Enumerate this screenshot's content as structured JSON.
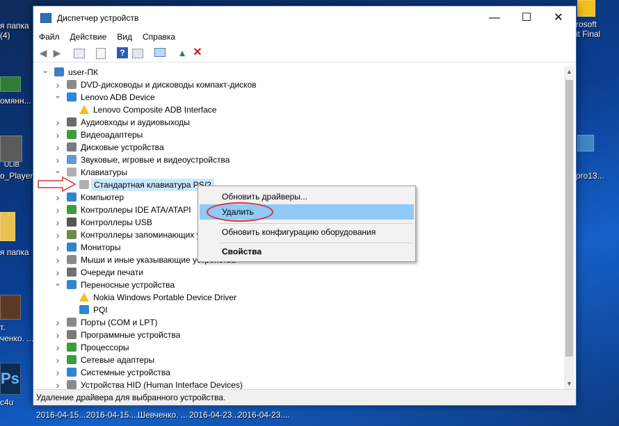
{
  "desktop": {
    "left_labels": [
      "я папка",
      "(4)",
      "омянн...",
      "o_Player",
      "я папка",
      "т.",
      "ченко. ...",
      "c4u"
    ],
    "right_labels": [
      "rosoft",
      "it Final",
      "pro13..."
    ],
    "taskbar_items": [
      "2016-04-15....",
      "2016-04-15....",
      "Шевченко. ...",
      "2016-04-23....",
      "2016-04-23...."
    ],
    "icon_label": "ULIB"
  },
  "window": {
    "title": "Диспетчер устройств",
    "minimize_glyph": "—",
    "maximize_glyph": "☐",
    "close_glyph": "✕",
    "menu": [
      "Файл",
      "Действие",
      "Вид",
      "Справка"
    ],
    "toolbar_icons": [
      "back-icon",
      "forward-icon",
      "properties-icon",
      "driver-icon",
      "help-icon",
      "view-icon",
      "scan-icon",
      "add-driver-icon",
      "uninstall-icon"
    ],
    "status_text": "Удаление драйвера для выбранного устройства."
  },
  "tree": [
    {
      "label": "user-ПК",
      "level": 0,
      "expanded": true,
      "icon": "computer-icon"
    },
    {
      "label": "DVD-дисководы и дисководы компакт-дисков",
      "level": 1,
      "expanded": false,
      "icon": "dvd-icon"
    },
    {
      "label": "Lenovo ADB Device",
      "level": 1,
      "expanded": true,
      "icon": "device-icon"
    },
    {
      "label": "Lenovo Composite ADB Interface",
      "level": 2,
      "icon": "warning-icon"
    },
    {
      "label": "Аудиовходы и аудиовыходы",
      "level": 1,
      "expanded": false,
      "icon": "audio-icon"
    },
    {
      "label": "Видеоадаптеры",
      "level": 1,
      "expanded": false,
      "icon": "display-adapter-icon"
    },
    {
      "label": "Дисковые устройства",
      "level": 1,
      "expanded": false,
      "icon": "disk-icon"
    },
    {
      "label": "Звуковые, игровые и видеоустройства",
      "level": 1,
      "expanded": false,
      "icon": "sound-icon"
    },
    {
      "label": "Клавиатуры",
      "level": 1,
      "expanded": true,
      "icon": "keyboard-icon"
    },
    {
      "label": "Стандартная клавиатура PS/2",
      "level": 2,
      "icon": "keyboard-icon",
      "selected": true
    },
    {
      "label": "Компьютер",
      "level": 1,
      "expanded": false,
      "icon": "monitor-icon"
    },
    {
      "label": "Контроллеры IDE ATA/ATAPI",
      "level": 1,
      "expanded": false,
      "icon": "ide-icon"
    },
    {
      "label": "Контроллеры USB",
      "level": 1,
      "expanded": false,
      "icon": "usb-icon"
    },
    {
      "label": "Контроллеры запоминающих у",
      "level": 1,
      "expanded": false,
      "icon": "storage-icon"
    },
    {
      "label": "Мониторы",
      "level": 1,
      "expanded": false,
      "icon": "monitor-icon"
    },
    {
      "label": "Мыши и иные указывающие устройства",
      "level": 1,
      "expanded": false,
      "icon": "mouse-icon"
    },
    {
      "label": "Очереди печати",
      "level": 1,
      "expanded": false,
      "icon": "printer-icon"
    },
    {
      "label": "Переносные устройства",
      "level": 1,
      "expanded": true,
      "icon": "portable-icon"
    },
    {
      "label": "Nokia Windows Portable Device Driver",
      "level": 2,
      "icon": "warning-icon"
    },
    {
      "label": "PQI",
      "level": 2,
      "icon": "portable-icon"
    },
    {
      "label": "Порты (COM и LPT)",
      "level": 1,
      "expanded": false,
      "icon": "port-icon"
    },
    {
      "label": "Программные устройства",
      "level": 1,
      "expanded": false,
      "icon": "software-icon"
    },
    {
      "label": "Процессоры",
      "level": 1,
      "expanded": false,
      "icon": "cpu-icon"
    },
    {
      "label": "Сетевые адаптеры",
      "level": 1,
      "expanded": false,
      "icon": "network-icon"
    },
    {
      "label": "Системные устройства",
      "level": 1,
      "expanded": false,
      "icon": "system-icon"
    },
    {
      "label": "Устройства HID (Human Interface Devices)",
      "level": 1,
      "expanded": false,
      "icon": "hid-icon"
    }
  ],
  "context_menu": {
    "items": [
      {
        "label": "Обновить драйверы...",
        "highlighted": false,
        "bold": false
      },
      {
        "label": "Удалить",
        "highlighted": true,
        "bold": false
      },
      {
        "label": "Обновить конфигурацию оборудования",
        "highlighted": false,
        "bold": false
      },
      {
        "label": "Свойства",
        "highlighted": false,
        "bold": true
      }
    ]
  },
  "colors": {
    "selection": "#cce8ff",
    "menu_highlight": "#91c9f7",
    "annotation_red": "#d8303a",
    "window_border": "#3d6cb5"
  }
}
